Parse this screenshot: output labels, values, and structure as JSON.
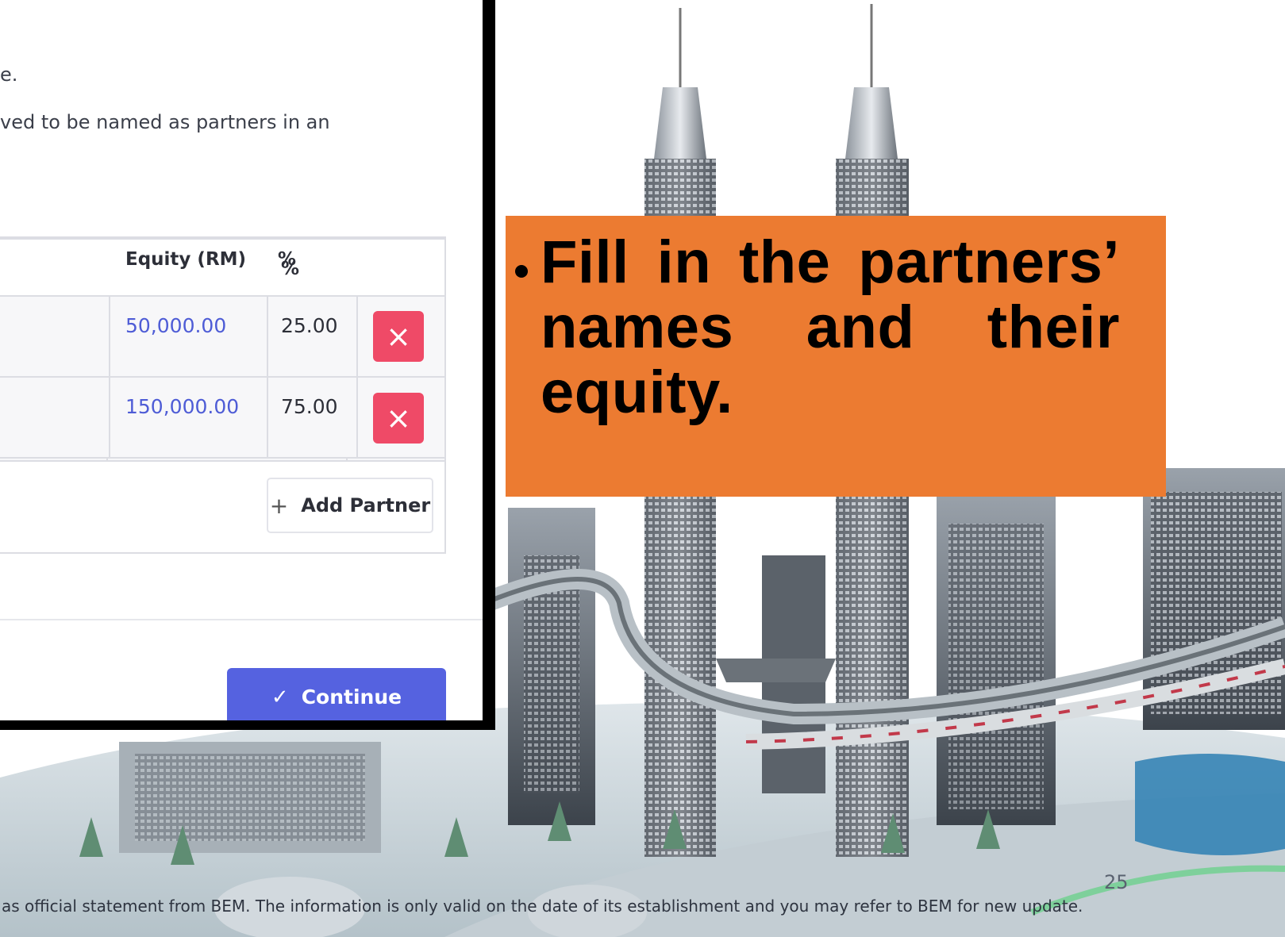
{
  "form": {
    "text_line1": "e.",
    "text_line2": "ved to be named as partners in an",
    "table": {
      "headers": {
        "equity": "Equity (RM)",
        "percent": "%"
      },
      "rows": [
        {
          "equity": "50,000.00",
          "percent": "25.00"
        },
        {
          "equity": "150,000.00",
          "percent": "75.00"
        }
      ],
      "delete_glyph": "×"
    },
    "add_partner": {
      "icon_glyph": "+",
      "label": "Add Partner"
    },
    "continue": {
      "icon_glyph": "✓",
      "label": "Continue"
    }
  },
  "callout": {
    "bullet_text": "Fill in the partners’ names and their equity.",
    "background_color": "#ec7b31"
  },
  "footer": {
    "page_number": "25",
    "disclaimer": "as official statement from BEM. The information is only valid on the date of its establishment and you may refer to BEM for new update."
  },
  "colors": {
    "primary_button": "#5562e0",
    "delete_button": "#ef4a67",
    "equity_text": "#4e5cd6"
  }
}
